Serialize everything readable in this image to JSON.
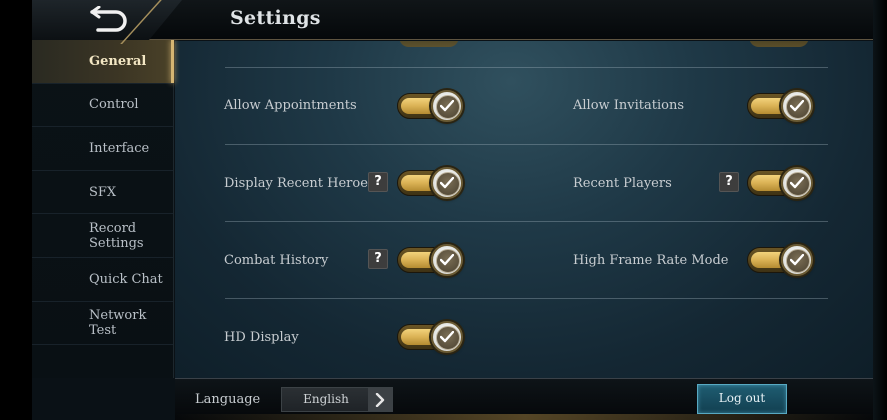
{
  "header": {
    "title": "Settings",
    "back_icon": "back-arrow-icon"
  },
  "sidebar": {
    "items": [
      {
        "label": "General",
        "active": true
      },
      {
        "label": "Control",
        "active": false
      },
      {
        "label": "Interface",
        "active": false
      },
      {
        "label": "SFX",
        "active": false
      },
      {
        "label": "Record Settings",
        "active": false
      },
      {
        "label": "Quick Chat",
        "active": false
      },
      {
        "label": "Network Test",
        "active": false
      }
    ]
  },
  "settings": {
    "allow_appointments": {
      "label": "Allow Appointments",
      "on": true
    },
    "allow_invitations": {
      "label": "Allow Invitations",
      "on": true
    },
    "display_recent_heroes": {
      "label": "Display Recent Heroes",
      "on": true,
      "help": "?"
    },
    "recent_players": {
      "label": "Recent Players",
      "on": true,
      "help": "?"
    },
    "combat_history": {
      "label": "Combat History",
      "on": true,
      "help": "?"
    },
    "high_frame_rate_mode": {
      "label": "High Frame Rate Mode",
      "on": true
    },
    "hd_display": {
      "label": "HD Display",
      "on": true
    }
  },
  "footer": {
    "language_label": "Language",
    "language_value": "English",
    "logout_label": "Log out"
  },
  "colors": {
    "accent_gold": "#dab255",
    "logout_blue": "#1f5d72",
    "active_tab_glow": "#d5b572"
  }
}
